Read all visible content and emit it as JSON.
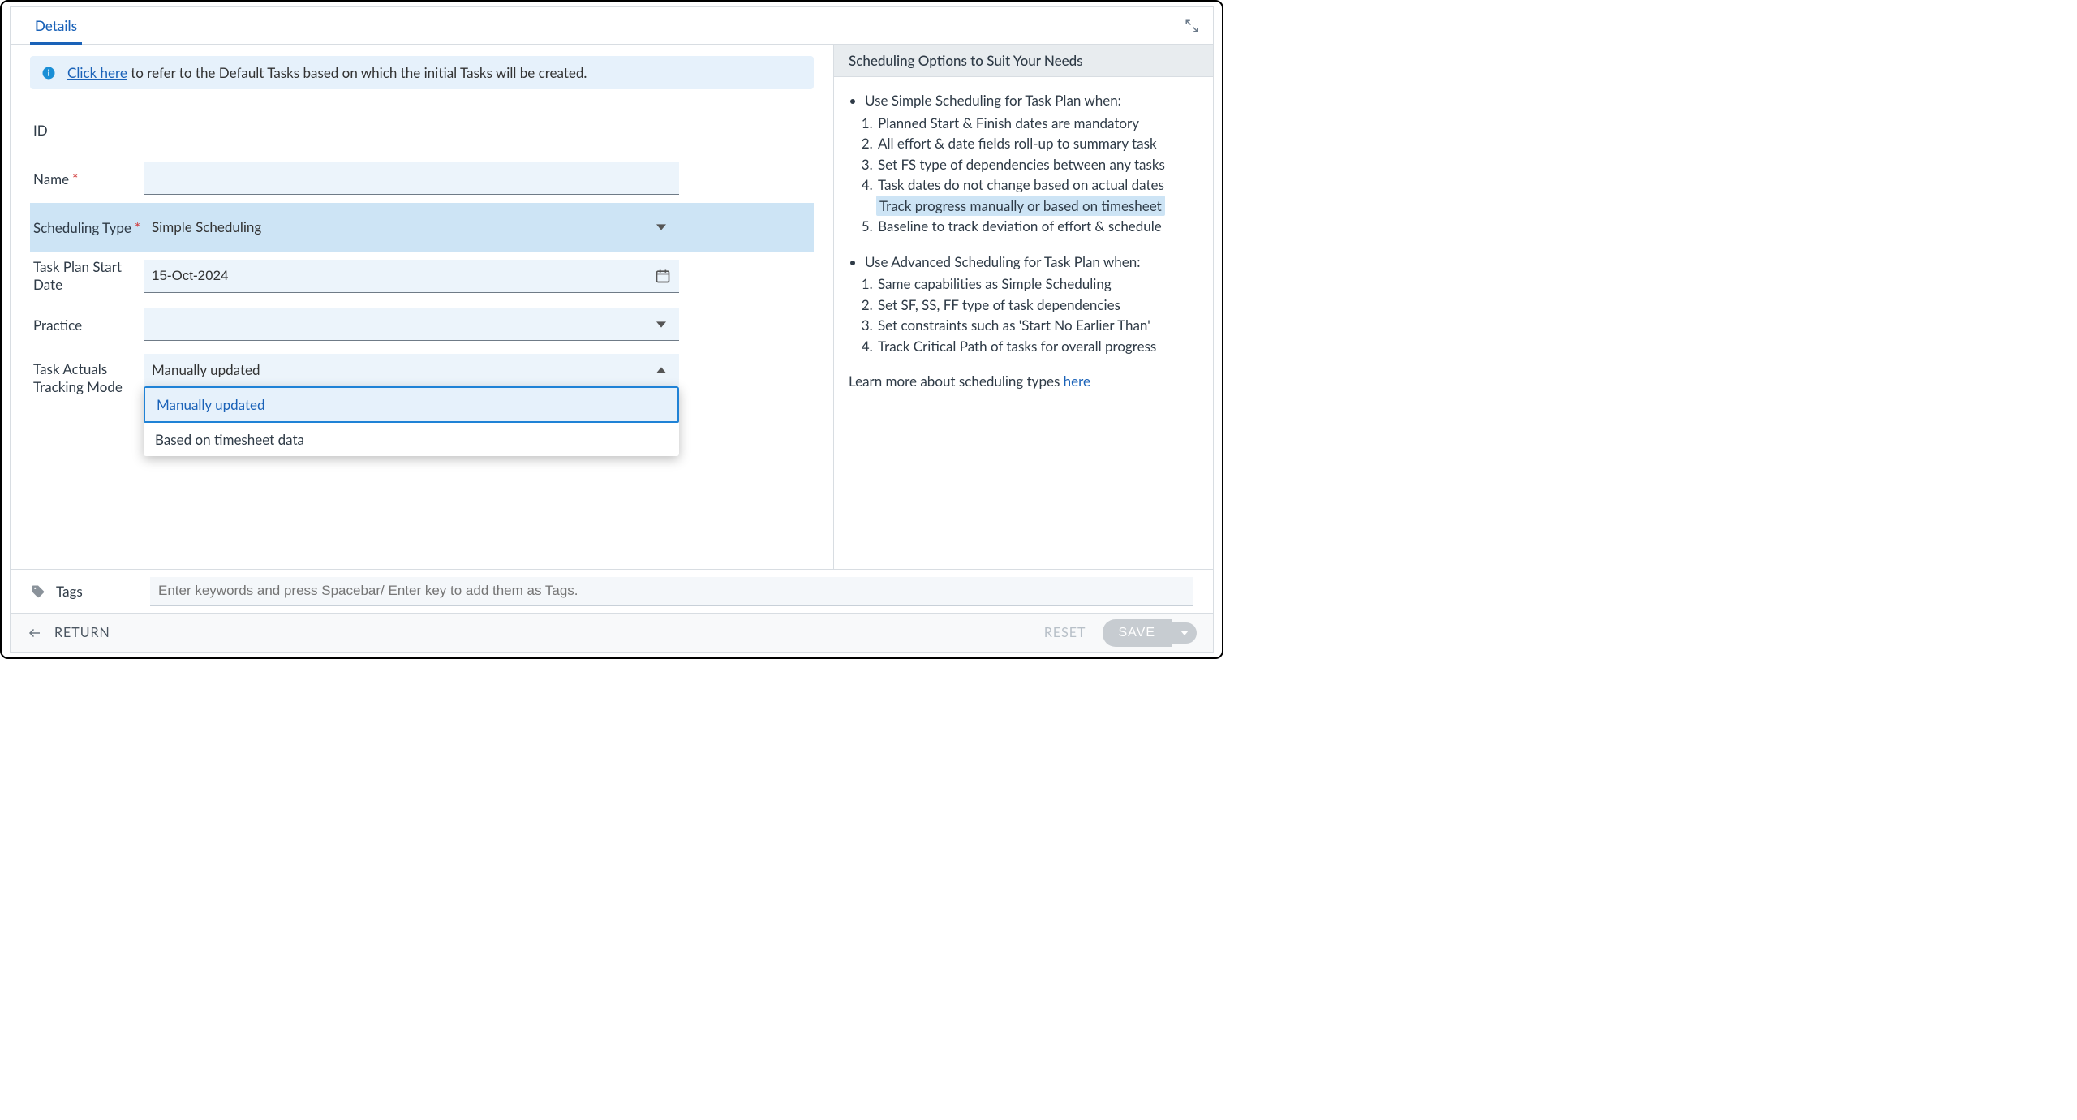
{
  "tabs": {
    "details": "Details"
  },
  "banner": {
    "link_text": "Click here",
    "rest_text": " to refer to the Default Tasks based on which the initial Tasks will be created."
  },
  "fields": {
    "id": {
      "label": "ID",
      "value": ""
    },
    "name": {
      "label": "Name",
      "value": "",
      "required": true
    },
    "scheduling_type": {
      "label": "Scheduling Type",
      "value": "Simple Scheduling",
      "required": true
    },
    "start_date": {
      "label": "Task Plan Start Date",
      "value": "15-Oct-2024"
    },
    "practice": {
      "label": "Practice",
      "value": ""
    },
    "actuals_mode": {
      "label": "Task Actuals Tracking Mode",
      "value": "Manually updated",
      "options": [
        "Manually updated",
        "Based on timesheet data"
      ],
      "selected_index": 0
    }
  },
  "sidebar": {
    "title": "Scheduling Options to Suit Your Needs",
    "simple_intro": "Use Simple Scheduling for Task Plan when:",
    "simple_points": [
      "Planned Start & Finish dates are mandatory",
      "All effort & date fields roll-up to summary task",
      "Set FS type of dependencies between any tasks",
      "Task dates do not change based on actual dates",
      "Track progress manually or based on timesheet",
      "Baseline to track deviation of effort & schedule"
    ],
    "simple_highlight_index": 4,
    "advanced_intro": "Use Advanced Scheduling for Task Plan when:",
    "advanced_points": [
      "Same capabilities as Simple Scheduling",
      "Set SF, SS, FF type of task dependencies",
      "Set constraints such as 'Start No Earlier Than'",
      "Track Critical Path of tasks for overall progress"
    ],
    "learn_text": "Learn more about scheduling types ",
    "learn_link": "here"
  },
  "tags": {
    "label": "Tags",
    "placeholder": "Enter keywords and press Spacebar/ Enter key to add them as Tags."
  },
  "footer": {
    "return": "RETURN",
    "reset": "RESET",
    "save": "SAVE"
  }
}
